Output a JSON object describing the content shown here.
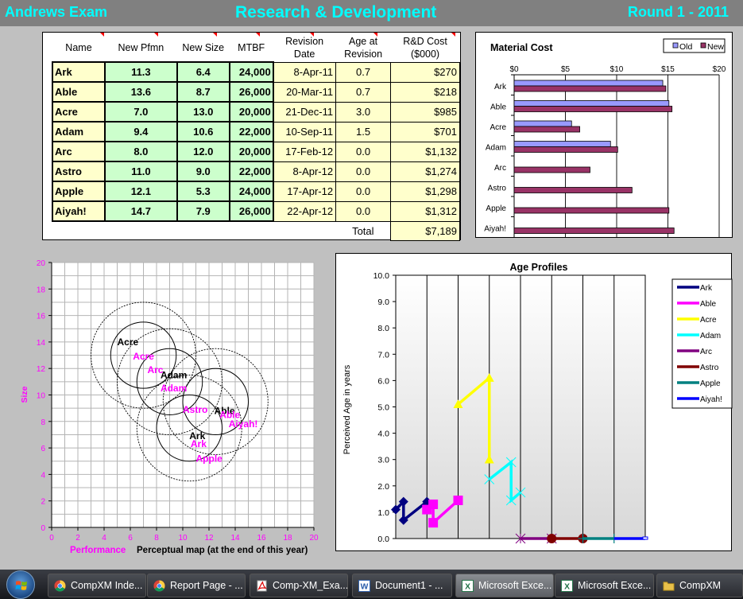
{
  "header": {
    "left": "Andrews Exam",
    "center": "Research & Development",
    "right": "Round 1 - 2011"
  },
  "table": {
    "columns": [
      "Name",
      "New Pfmn",
      "New Size",
      "MTBF",
      "Revision Date",
      "Age at Revision",
      "R&D Cost ($000)"
    ],
    "column_lines": [
      [
        "Name"
      ],
      [
        "New Pfmn"
      ],
      [
        "New Size"
      ],
      [
        "MTBF"
      ],
      [
        "Revision",
        "Date"
      ],
      [
        "Age at",
        "Revision"
      ],
      [
        "R&D Cost",
        "($000)"
      ]
    ],
    "rows": [
      {
        "name": "Ark",
        "pfmn": "11.3",
        "size": "6.4",
        "mtbf": "24,000",
        "date": "8-Apr-11",
        "age": "0.7",
        "cost": "$270"
      },
      {
        "name": "Able",
        "pfmn": "13.6",
        "size": "8.7",
        "mtbf": "26,000",
        "date": "20-Mar-11",
        "age": "0.7",
        "cost": "$218"
      },
      {
        "name": "Acre",
        "pfmn": "7.0",
        "size": "13.0",
        "mtbf": "20,000",
        "date": "21-Dec-11",
        "age": "3.0",
        "cost": "$985"
      },
      {
        "name": "Adam",
        "pfmn": "9.4",
        "size": "10.6",
        "mtbf": "22,000",
        "date": "10-Sep-11",
        "age": "1.5",
        "cost": "$701"
      },
      {
        "name": "Arc",
        "pfmn": "8.0",
        "size": "12.0",
        "mtbf": "20,000",
        "date": "17-Feb-12",
        "age": "0.0",
        "cost": "$1,132"
      },
      {
        "name": "Astro",
        "pfmn": "11.0",
        "size": "9.0",
        "mtbf": "22,000",
        "date": "8-Apr-12",
        "age": "0.0",
        "cost": "$1,274"
      },
      {
        "name": "Apple",
        "pfmn": "12.1",
        "size": "5.3",
        "mtbf": "24,000",
        "date": "17-Apr-12",
        "age": "0.0",
        "cost": "$1,298"
      },
      {
        "name": "Aiyah!",
        "pfmn": "14.7",
        "size": "7.9",
        "mtbf": "26,000",
        "date": "22-Apr-12",
        "age": "0.0",
        "cost": "$1,312"
      }
    ],
    "total_label": "Total",
    "total_value": "$7,189"
  },
  "chart_data": [
    {
      "type": "bar",
      "orientation": "horizontal",
      "title": "Material Cost",
      "categories": [
        "Ark",
        "Able",
        "Acre",
        "Adam",
        "Arc",
        "Astro",
        "Apple",
        "Aiyah!"
      ],
      "series": [
        {
          "name": "Old",
          "color": "#9999ff",
          "values": [
            14.5,
            15.1,
            5.6,
            9.4,
            null,
            null,
            null,
            null
          ]
        },
        {
          "name": "New",
          "color": "#993366",
          "values": [
            14.8,
            15.4,
            6.4,
            10.1,
            7.4,
            11.5,
            15.1,
            15.6
          ]
        }
      ],
      "xlim": [
        0,
        20
      ],
      "xticks": [
        "$0",
        "$5",
        "$10",
        "$15",
        "$20"
      ],
      "legend": "top-right",
      "grid": true
    },
    {
      "type": "scatter",
      "title": "Perceptual map (at the end of this year)",
      "xlabel": "Performance",
      "ylabel": "Size",
      "xlim": [
        0,
        20
      ],
      "ylim": [
        0,
        20
      ],
      "xticks": [
        "0",
        "2",
        "4",
        "6",
        "8",
        "10",
        "12",
        "14",
        "16",
        "18",
        "20"
      ],
      "yticks": [
        "0",
        "2",
        "4",
        "6",
        "8",
        "10",
        "12",
        "14",
        "16",
        "18",
        "20"
      ],
      "grid": true,
      "segments": [
        {
          "cx": 7.0,
          "cy": 13.0,
          "inner_r": 2.5,
          "outer_r": 4.0
        },
        {
          "cx": 9.0,
          "cy": 11.0,
          "inner_r": 2.5,
          "outer_r": 4.0
        },
        {
          "cx": 12.5,
          "cy": 9.5,
          "inner_r": 2.5,
          "outer_r": 4.0
        },
        {
          "cx": 10.5,
          "cy": 7.5,
          "inner_r": 2.5,
          "outer_r": 4.0
        }
      ],
      "points_current": [
        {
          "name": "Acre",
          "x": 5.0,
          "y": 14.0
        },
        {
          "name": "Adam",
          "x": 8.3,
          "y": 11.5
        },
        {
          "name": "Able",
          "x": 12.4,
          "y": 8.8
        },
        {
          "name": "Ark",
          "x": 10.5,
          "y": 6.9
        }
      ],
      "points_next": [
        {
          "name": "Acre",
          "x": 6.2,
          "y": 12.9
        },
        {
          "name": "Arc",
          "x": 7.3,
          "y": 11.9
        },
        {
          "name": "Adam",
          "x": 8.3,
          "y": 10.5
        },
        {
          "name": "Astro",
          "x": 10.0,
          "y": 8.9
        },
        {
          "name": "Able",
          "x": 12.8,
          "y": 8.5
        },
        {
          "name": "Aiyah!",
          "x": 13.5,
          "y": 7.8
        },
        {
          "name": "Ark",
          "x": 10.6,
          "y": 6.3
        },
        {
          "name": "Apple",
          "x": 11.0,
          "y": 5.2
        }
      ],
      "current_color": "#000000",
      "next_color": "#ff00ff"
    },
    {
      "type": "line",
      "title": "Age Profiles",
      "ylabel": "Perceived Age in years",
      "ylim": [
        0,
        10
      ],
      "yticks": [
        "0.0",
        "1.0",
        "2.0",
        "3.0",
        "4.0",
        "5.0",
        "6.0",
        "7.0",
        "8.0",
        "9.0",
        "10.0"
      ],
      "x_categories": 8,
      "legend": "right",
      "series": [
        {
          "name": "Ark",
          "color": "#000080",
          "marker": "diamond",
          "points": [
            [
              0.0,
              1.1
            ],
            [
              0.25,
              1.4
            ],
            [
              0.25,
              0.7
            ],
            [
              1.0,
              1.4
            ]
          ]
        },
        {
          "name": "Able",
          "color": "#ff00ff",
          "marker": "square",
          "points": [
            [
              1.0,
              1.1
            ],
            [
              1.2,
              1.3
            ],
            [
              1.2,
              0.6
            ],
            [
              2.0,
              1.45
            ]
          ]
        },
        {
          "name": "Acre",
          "color": "#ffff00",
          "marker": "triangle",
          "points": [
            [
              2.0,
              5.1
            ],
            [
              3.0,
              6.1
            ],
            [
              3.0,
              3.0
            ]
          ]
        },
        {
          "name": "Adam",
          "color": "#00ffff",
          "marker": "x",
          "points": [
            [
              3.0,
              2.25
            ],
            [
              3.7,
              2.9
            ],
            [
              3.7,
              1.45
            ],
            [
              4.0,
              1.75
            ]
          ]
        },
        {
          "name": "Arc",
          "color": "#800080",
          "marker": "star",
          "points": [
            [
              4.0,
              0.0
            ],
            [
              5.0,
              0.0
            ]
          ]
        },
        {
          "name": "Astro",
          "color": "#800000",
          "marker": "circle",
          "points": [
            [
              5.0,
              0.0
            ],
            [
              6.0,
              0.0
            ]
          ]
        },
        {
          "name": "Apple",
          "color": "#008080",
          "marker": "plus",
          "points": [
            [
              6.0,
              0.0
            ],
            [
              7.0,
              0.0
            ]
          ]
        },
        {
          "name": "Aiyah!",
          "color": "#0000ff",
          "marker": "dash",
          "points": [
            [
              7.0,
              0.0
            ],
            [
              8.0,
              0.0
            ]
          ]
        }
      ]
    }
  ],
  "taskbar": {
    "items": [
      {
        "label": "CompXM Inde...",
        "icon": "chrome-icon",
        "active": false
      },
      {
        "label": "Report Page - ...",
        "icon": "chrome-icon",
        "active": false
      },
      {
        "label": "Comp-XM_Exa...",
        "icon": "pdf-icon",
        "active": false
      },
      {
        "label": "Document1 - ...",
        "icon": "word-icon",
        "active": false
      },
      {
        "label": "Microsoft Exce...",
        "icon": "excel-icon",
        "active": true
      },
      {
        "label": "Microsoft Exce...",
        "icon": "excel-icon",
        "active": false
      },
      {
        "label": "CompXM",
        "icon": "folder-icon",
        "active": false
      }
    ]
  }
}
